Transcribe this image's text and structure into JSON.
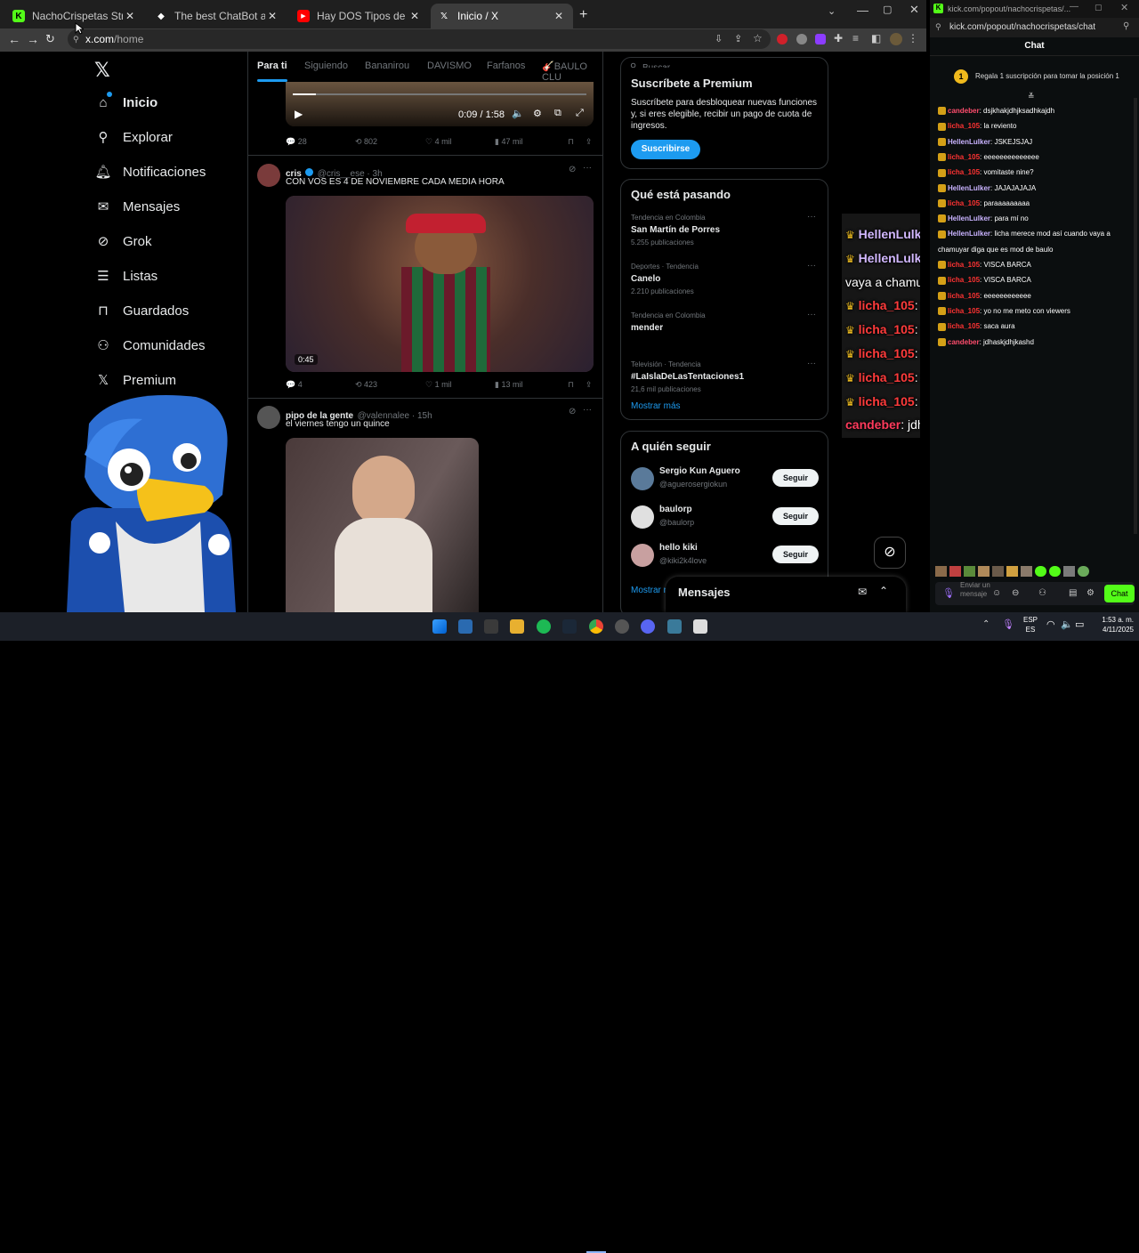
{
  "tabs": [
    {
      "title": "NachoCrispetas Stream - Watch L",
      "icon": "kick-icon",
      "color": "#53fc18",
      "active": false
    },
    {
      "title": "The best ChatBot and Widg",
      "icon": "chatbot-icon",
      "color": "#ffffff",
      "active": false
    },
    {
      "title": "Hay DOS Tipos de Personas - ¿C",
      "icon": "youtube-icon",
      "color": "#ff0000",
      "active": false
    },
    {
      "title": "Inicio / X",
      "icon": "x-logo-icon",
      "color": "#ffffff",
      "active": true
    }
  ],
  "address": {
    "url": "x.com/home",
    "host": "x.com",
    "path": "/home"
  },
  "nav": {
    "items": [
      {
        "label": "Inicio",
        "icon": "home-icon"
      },
      {
        "label": "Explorar",
        "icon": "search-icon"
      },
      {
        "label": "Notificaciones",
        "icon": "bell-icon"
      },
      {
        "label": "Mensajes",
        "icon": "mail-icon"
      },
      {
        "label": "Grok",
        "icon": "grok-icon"
      },
      {
        "label": "Listas",
        "icon": "list-icon"
      },
      {
        "label": "Guardados",
        "icon": "bookmark-icon"
      },
      {
        "label": "Comunidades",
        "icon": "people-icon"
      },
      {
        "label": "Premium",
        "icon": "x-logo-icon"
      }
    ]
  },
  "feed": {
    "tabs": [
      "Para ti",
      "Siguiendo",
      "Bananirou",
      "DAVISMO",
      "Farfanos",
      "🎸BAULO CLU"
    ],
    "video1": {
      "time": "0:09 / 1:58"
    },
    "post1_actions": {
      "replies": "28",
      "reposts": "802",
      "likes": "4 mil",
      "views": "47 mil"
    },
    "post2": {
      "name": "cris",
      "handle": "@cris__ese · 3h",
      "text": "CON VOS ES 4 DE NOVIEMBRE CADA MEDIA HORA",
      "duration": "0:45",
      "actions": {
        "replies": "4",
        "reposts": "423",
        "likes": "1 mil",
        "views": "13 mil"
      }
    },
    "post3": {
      "name": "pipo de la gente",
      "handle": "@valennalee · 15h",
      "text": "el viernes tengo un quince"
    }
  },
  "search": {
    "placeholder": "Buscar"
  },
  "premium": {
    "title": "Suscríbete a Premium",
    "body": "Suscríbete para desbloquear nuevas funciones y, si eres elegible, recibir un pago de cuota de ingresos.",
    "button": "Suscribirse"
  },
  "trends": {
    "title": "Qué está pasando",
    "items": [
      {
        "meta": "Tendencia en Colombia",
        "name": "San Martín de Porres",
        "count": "5.255 publicaciones"
      },
      {
        "meta": "Deportes · Tendencia",
        "name": "Canelo",
        "count": "2.210 publicaciones"
      },
      {
        "meta": "Tendencia en Colombia",
        "name": "mender",
        "count": ""
      },
      {
        "meta": "Televisión · Tendencia",
        "name": "#LaIslaDeLasTentaciones1",
        "count": "21,6 mil publicaciones"
      }
    ],
    "more": "Mostrar más"
  },
  "follow": {
    "title": "A quién seguir",
    "items": [
      {
        "name": "Sergio Kun Aguero",
        "handle": "@aguerosergiokun",
        "button": "Seguir"
      },
      {
        "name": "baulorp",
        "handle": "@baulorp",
        "button": "Seguir"
      },
      {
        "name": "hello kiki",
        "handle": "@kiki2k4love",
        "button": "Seguir"
      }
    ],
    "more": "Mostrar m"
  },
  "messages_drawer": {
    "title": "Mensajes"
  },
  "popout": {
    "url": "kick.com/popout/nachocrispetas/chat",
    "window_title": "kick.com/popout/nachocrispetas/...",
    "chat_title": "Chat",
    "pinned": "Regala 1 suscripción para tomar la posición 1",
    "pinned_rank": "1",
    "input_placeholder": "Enviar un mensaje",
    "send_label": "Chat"
  },
  "chat": [
    {
      "user": "candeber",
      "color": "#ff4d6d",
      "text": "dsjkhakjdhjksadhkajdh"
    },
    {
      "user": "licha_105",
      "color": "#ff3333",
      "text": "la reviento"
    },
    {
      "user": "HellenLulker",
      "color": "#c9b3ff",
      "text": "JSKEJSJAJ"
    },
    {
      "user": "licha_105",
      "color": "#ff3333",
      "text": "eeeeeeeeeeeeee"
    },
    {
      "user": "licha_105",
      "color": "#ff3333",
      "text": "vomitaste nine?"
    },
    {
      "user": "HellenLulker",
      "color": "#c9b3ff",
      "text": "JAJAJAJAJA"
    },
    {
      "user": "licha_105",
      "color": "#ff3333",
      "text": "paraaaaaaaaa"
    },
    {
      "user": "HellenLulker",
      "color": "#c9b3ff",
      "text": "para mí no"
    },
    {
      "user": "HellenLulker",
      "color": "#c9b3ff",
      "text": "licha merece mod así cuando vaya a"
    },
    {
      "user": "",
      "color": "#ffffff",
      "text": "chamuyar diga que es mod de baulo"
    },
    {
      "user": "licha_105",
      "color": "#ff3333",
      "text": "VISCA BARCA"
    },
    {
      "user": "licha_105",
      "color": "#ff3333",
      "text": "VISCA BARCA"
    },
    {
      "user": "licha_105",
      "color": "#ff3333",
      "text": "eeeeeeeeeeee"
    },
    {
      "user": "licha_105",
      "color": "#ff3333",
      "text": "yo no me meto con viewers"
    },
    {
      "user": "licha_105",
      "color": "#ff3333",
      "text": "saca aura"
    },
    {
      "user": "candeber",
      "color": "#ff4d6d",
      "text": "jdhaskjdhjkashd"
    }
  ],
  "overlay_chat": [
    {
      "user": "HellenLulker",
      "color": "#d2b8ff",
      "text": "para mí no",
      "badge": "sword-crown"
    },
    {
      "user": "HellenLulker",
      "color": "#d2b8ff",
      "text": "licha merece mod así cuando",
      "badge": "sword-crown"
    },
    {
      "user": "",
      "color": "#ffffff",
      "text": "vaya a chamuyar diga que es mod de baulo",
      "badge": ""
    },
    {
      "user": "licha_105",
      "color": "#ff3b3b",
      "text": "VISCA BARCA",
      "badge": "crown"
    },
    {
      "user": "licha_105",
      "color": "#ff3b3b",
      "text": "VISCA BARCA",
      "badge": "crown"
    },
    {
      "user": "licha_105",
      "color": "#ff3b3b",
      "text": "eeeeeeeeeeee",
      "badge": "crown"
    },
    {
      "user": "licha_105",
      "color": "#ff3b3b",
      "text": "yo no me meto con viewers",
      "badge": "crown"
    },
    {
      "user": "licha_105",
      "color": "#ff3b3b",
      "text": "saca aura",
      "badge": "crown"
    },
    {
      "user": "candeber",
      "color": "#ff3b5c",
      "text": "jdhaskjdhjkashd",
      "badge": ""
    }
  ],
  "taskbar": {
    "lang": "ESP",
    "lang2": "ES",
    "time": "1:53 a. m.",
    "date": "4/11/2025"
  }
}
